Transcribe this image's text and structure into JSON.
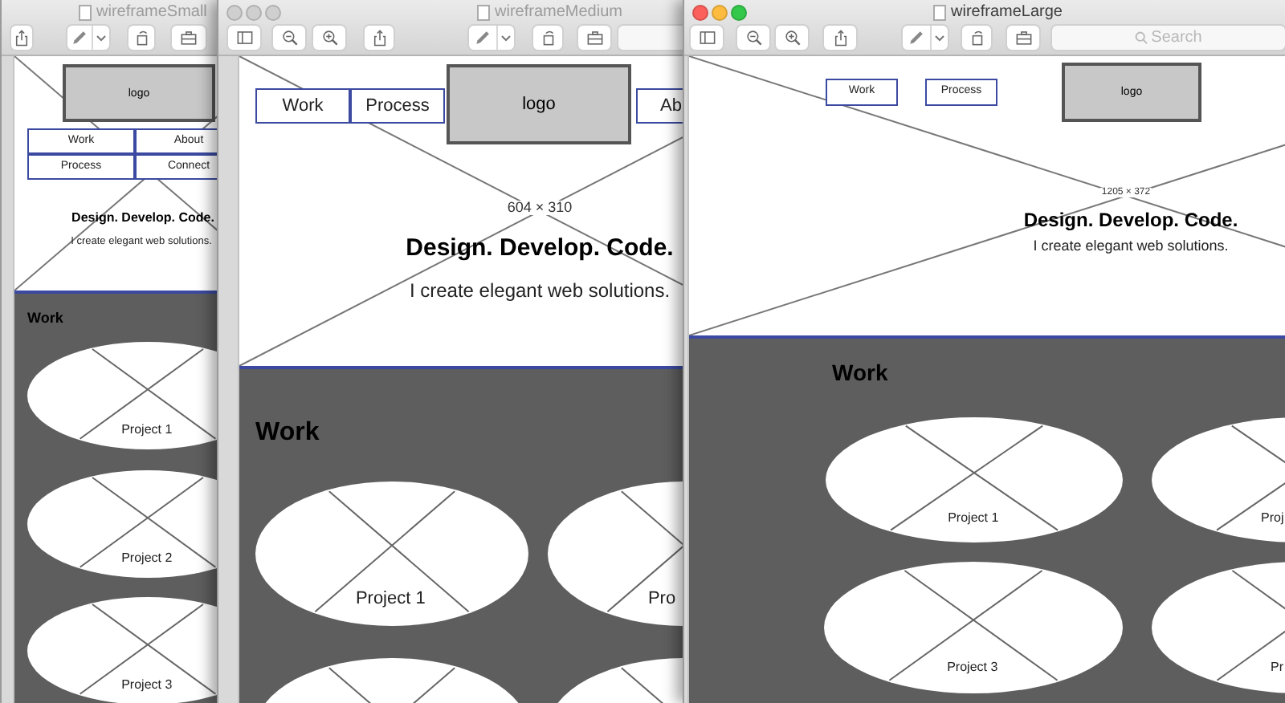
{
  "windows": [
    {
      "kind": "narrow",
      "title": "wireframeSmall",
      "active": false,
      "toolbar": [
        {
          "kind": "share"
        },
        {
          "kind": "markup"
        },
        {
          "kind": "rotate"
        },
        {
          "kind": "toolbox"
        }
      ],
      "page": {
        "logo": "logo",
        "nav": [
          "Work",
          "About",
          "Process",
          "Connect"
        ],
        "headline": "Design. Develop. Code.",
        "tagline": "I create elegant web solutions.",
        "section_title": "Work",
        "projects": [
          {
            "kind": "oval",
            "label": "Project 1"
          },
          {
            "kind": "oval",
            "label": "Project 2"
          },
          {
            "kind": "oval",
            "label": "Project 3"
          }
        ]
      }
    },
    {
      "kind": "medium",
      "title": "wireframeMedium",
      "active": false,
      "toolbar": [
        {
          "kind": "sidebar"
        },
        {
          "kind": "zoom-out"
        },
        {
          "kind": "zoom-in"
        },
        {
          "kind": "share"
        },
        {
          "kind": "markup"
        },
        {
          "kind": "rotate"
        },
        {
          "kind": "toolbox"
        },
        {
          "kind": "search"
        }
      ],
      "page": {
        "logo": "logo",
        "nav": [
          "Work",
          "Process",
          "Ab"
        ],
        "size_label": "604 × 310",
        "headline": "Design. Develop. Code.",
        "tagline": "I create elegant web solutions.",
        "section_title": "Work",
        "projects": [
          {
            "kind": "oval",
            "label": "Project 1"
          },
          {
            "kind": "oval",
            "label": "Pro"
          },
          {
            "kind": "oval"
          },
          {
            "kind": "oval"
          }
        ]
      }
    },
    {
      "kind": "wide",
      "title": "wireframeLarge",
      "active": true,
      "toolbar": [
        {
          "kind": "sidebar"
        },
        {
          "kind": "zoom-out"
        },
        {
          "kind": "zoom-in"
        },
        {
          "kind": "share"
        },
        {
          "kind": "markup"
        },
        {
          "kind": "rotate"
        },
        {
          "kind": "toolbox"
        },
        {
          "kind": "search",
          "placeholder": "Search"
        }
      ],
      "page": {
        "logo": "logo",
        "nav": [
          "Work",
          "Process"
        ],
        "size_label": "1205 × 372",
        "headline": "Design. Develop. Code.",
        "tagline": "I create elegant web solutions.",
        "section_title": "Work",
        "projects": [
          {
            "kind": "oval",
            "label": "Project 1"
          },
          {
            "kind": "oval",
            "label": "Proj"
          },
          {
            "kind": "oval",
            "label": "Project 3"
          },
          {
            "kind": "oval",
            "label": "Pr"
          }
        ]
      }
    }
  ]
}
